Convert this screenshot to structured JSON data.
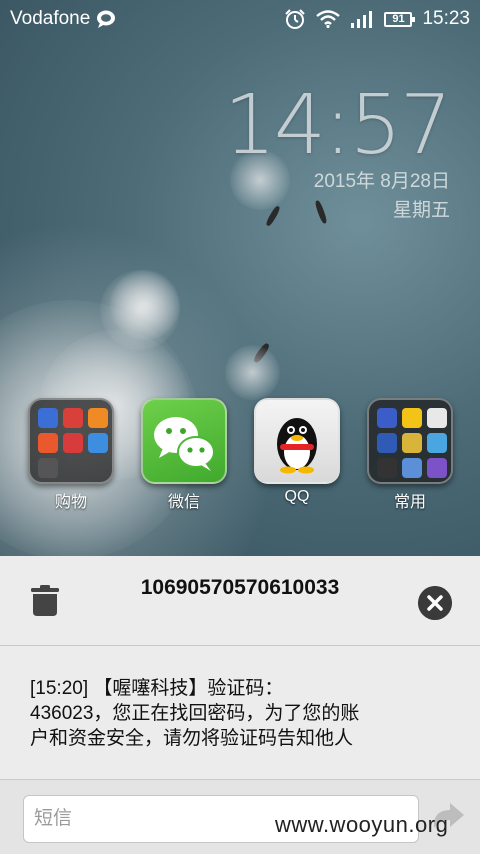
{
  "status_bar": {
    "carrier": "Vodafone",
    "battery": "91",
    "time": "15:23",
    "icons": [
      "message-bubble-icon",
      "alarm-icon",
      "wifi-icon",
      "signal-icon",
      "battery-icon"
    ]
  },
  "clock_widget": {
    "time": "14:57",
    "date": "2015年 8月28日",
    "weekday": "星期五"
  },
  "apps": [
    {
      "label": "购物"
    },
    {
      "label": "微信"
    },
    {
      "label": "QQ"
    },
    {
      "label": "常用"
    }
  ],
  "message": {
    "sender": "10690570570610033",
    "body_line1": "[15:20] 【喔噻科技】验证码：",
    "body_line2": "436023，您正在找回密码，为了您的账",
    "body_line3": "户和资金安全，请勿将验证码告知他人"
  },
  "compose": {
    "placeholder": "短信"
  },
  "watermark": "www.wooyun.org",
  "colors": {
    "panel_bg": "#ececec",
    "wechat_green": "#4cb834"
  }
}
